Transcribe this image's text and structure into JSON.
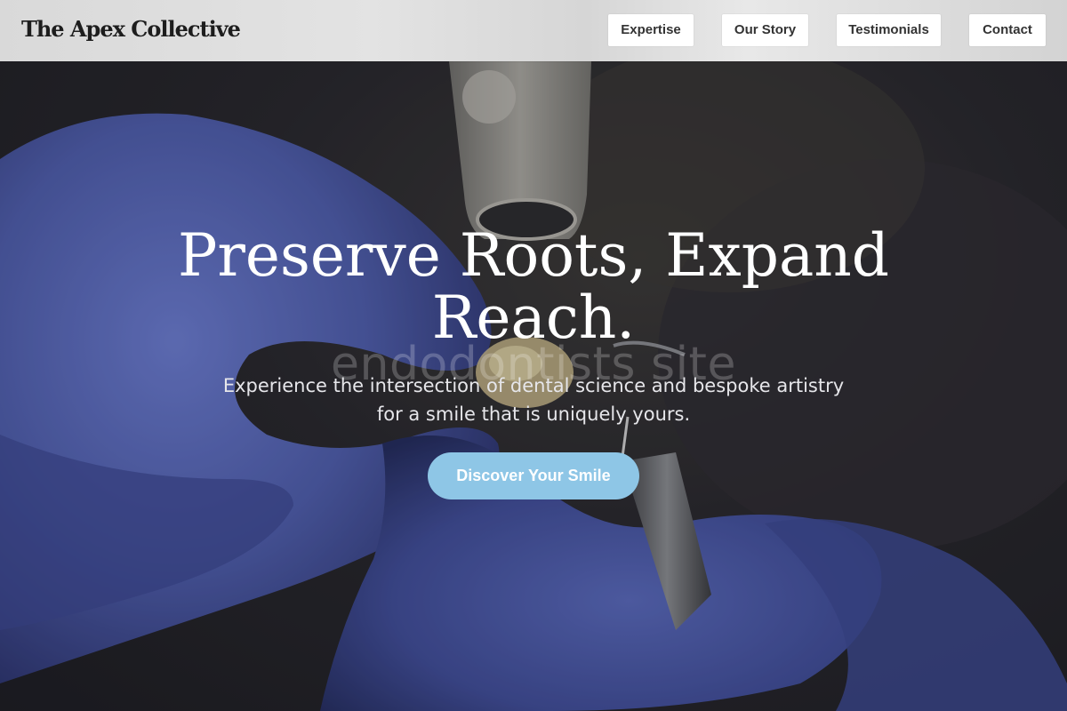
{
  "header": {
    "brand": "The Apex Collective",
    "nav": [
      {
        "label": "Expertise"
      },
      {
        "label": "Our Story"
      },
      {
        "label": "Testimonials"
      },
      {
        "label": "Contact"
      }
    ]
  },
  "hero": {
    "title_line1": "Preserve Roots, Expand",
    "title_line2": "Reach.",
    "watermark": "endodontists site",
    "subtitle": "Experience the intersection of dental science and bespoke artistry for a smile that is uniquely yours.",
    "cta_label": "Discover Your Smile"
  },
  "colors": {
    "cta": "#8ec6e6",
    "header_bg": "#dedede",
    "glove": "#4f5fae"
  }
}
